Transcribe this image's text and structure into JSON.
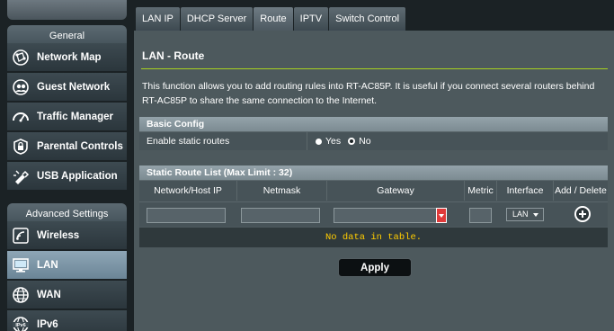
{
  "sidebar": {
    "top_stub_label": "",
    "general_header": "General",
    "general_items": [
      {
        "label": "Network Map",
        "icon": "network-map-icon"
      },
      {
        "label": "Guest Network",
        "icon": "guest-network-icon"
      },
      {
        "label": "Traffic Manager",
        "icon": "traffic-manager-icon"
      },
      {
        "label": "Parental Controls",
        "icon": "parental-controls-icon"
      },
      {
        "label": "USB Application",
        "icon": "usb-application-icon"
      }
    ],
    "advanced_header": "Advanced Settings",
    "advanced_items": [
      {
        "label": "Wireless",
        "icon": "wireless-icon"
      },
      {
        "label": "LAN",
        "icon": "lan-icon",
        "active": true
      },
      {
        "label": "WAN",
        "icon": "wan-icon"
      },
      {
        "label": "IPv6",
        "icon": "ipv6-icon"
      }
    ]
  },
  "tabs": [
    {
      "label": "LAN IP"
    },
    {
      "label": "DHCP Server"
    },
    {
      "label": "Route",
      "active": true
    },
    {
      "label": "IPTV"
    },
    {
      "label": "Switch Control"
    }
  ],
  "main": {
    "title": "LAN - Route",
    "description": "This function allows you to add routing rules into RT-AC85P. It is useful if you connect several routers behind RT-AC85P to share the same connection to the Internet.",
    "basic_config": {
      "header": "Basic Config",
      "enable_label": "Enable static routes",
      "options": [
        "Yes",
        "No"
      ],
      "selected": "No"
    },
    "route_list": {
      "header": "Static Route List (Max Limit : 32)",
      "columns": [
        "Network/Host IP",
        "Netmask",
        "Gateway",
        "Metric",
        "Interface",
        "Add / Delete"
      ],
      "interface_value": "LAN",
      "empty_message": "No data in table."
    },
    "apply_label": "Apply"
  },
  "colors": {
    "accent": "#a7d11f",
    "active_nav": "#7b95a6",
    "empty_text": "#ffcc00",
    "dropdown_arrow": "#e03a3a"
  }
}
